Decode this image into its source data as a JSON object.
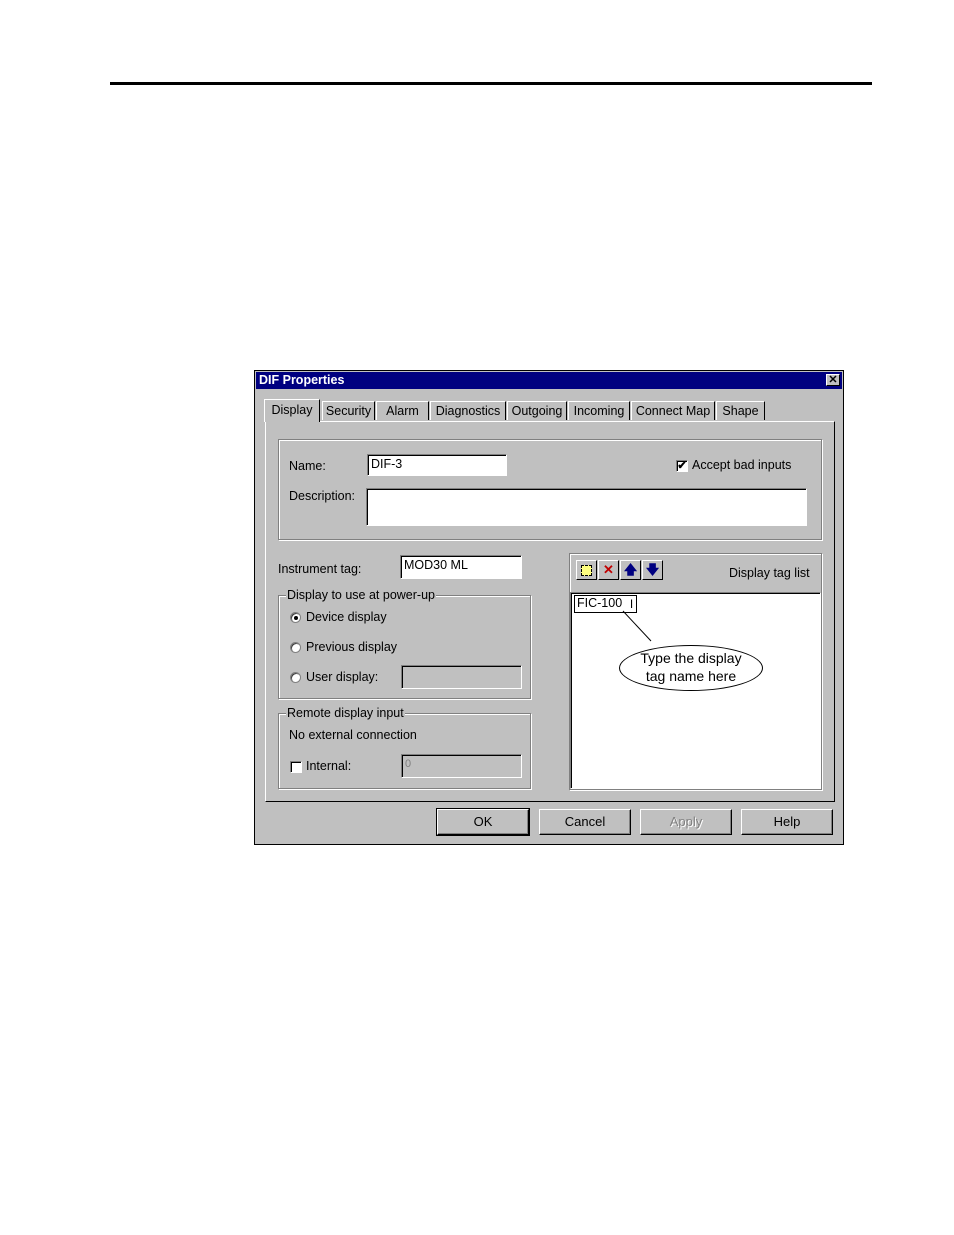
{
  "dialog": {
    "title": "DIF Properties",
    "close_glyph": "✕",
    "tabs": [
      {
        "label": "Display"
      },
      {
        "label": "Security"
      },
      {
        "label": "Alarm"
      },
      {
        "label": "Diagnostics"
      },
      {
        "label": "Outgoing"
      },
      {
        "label": "Incoming"
      },
      {
        "label": "Connect Map"
      },
      {
        "label": "Shape"
      }
    ],
    "active_tab": "Display",
    "name_label": "Name:",
    "name_value": "DIF-3",
    "accept_bad_inputs_label": "Accept bad inputs",
    "accept_bad_inputs_checked": true,
    "description_label": "Description:",
    "description_value": "",
    "instrument_tag_label": "Instrument tag:",
    "instrument_tag_value": "MOD30 ML",
    "powerup_group_title": "Display to use at power-up",
    "radio_device": "Device display",
    "radio_previous": "Previous display",
    "radio_user": "User display:",
    "selected_display": "Device display",
    "user_display_value": "",
    "remote_group_title": "Remote display input",
    "remote_status": "No external connection",
    "internal_label": "Internal:",
    "internal_value": "0",
    "internal_checked": false,
    "tag_list_title": "Display tag list",
    "tag_list_entry": "FIC-100",
    "toolbar_icons": [
      "new-icon",
      "delete-icon",
      "move-up-icon",
      "move-down-icon"
    ],
    "callout_line1": "Type the display",
    "callout_line2": "tag name here",
    "buttons": {
      "ok": "OK",
      "cancel": "Cancel",
      "apply": "Apply",
      "help": "Help"
    },
    "colors": {
      "titlebar": "#000080",
      "face": "#c0c0c0",
      "delete": "#c00000",
      "arrows": "#000080"
    }
  }
}
